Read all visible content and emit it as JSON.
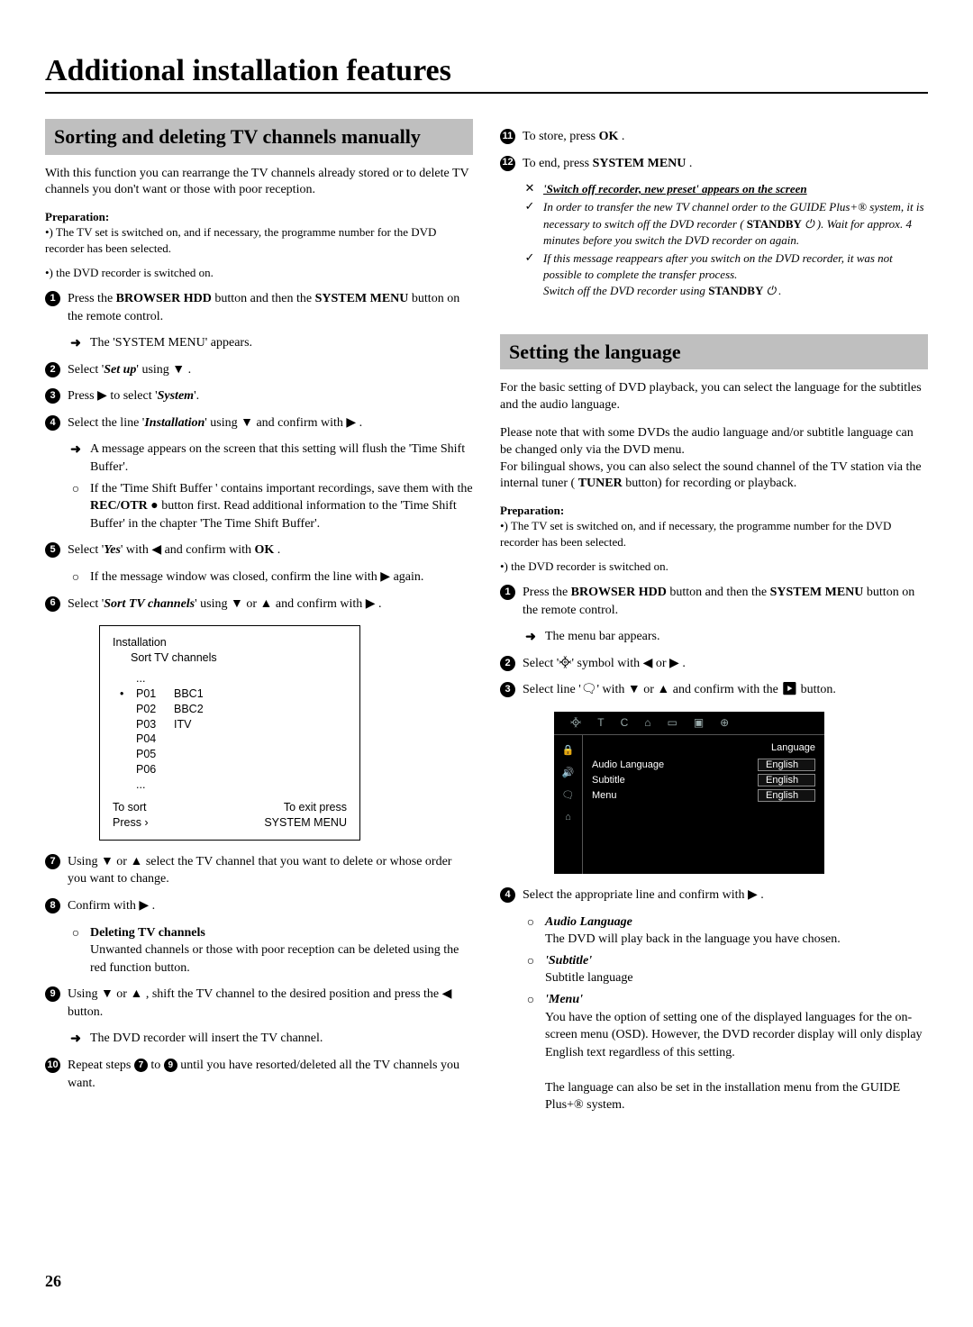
{
  "pageTitle": "Additional installation features",
  "pageNumber": 26,
  "sec1": {
    "heading": "Sorting and deleting TV channels manually",
    "intro": "With this function you can rearrange the TV channels already stored or to delete TV channels you don't want or those with poor reception.",
    "prepLabel": "Preparation:",
    "prep1": "•) The TV set is switched on, and if necessary, the programme number for the DVD recorder has been selected.",
    "prep2": "•) the DVD recorder is switched on.",
    "step1_a": "Press the ",
    "step1_b": "BROWSER HDD",
    "step1_c": " button and then the ",
    "step1_d": "SYSTEM MENU",
    "step1_e": " button on the remote control.",
    "step1_sub": "The 'SYSTEM MENU' appears.",
    "step2_a": "Select '",
    "step2_b": "Set up",
    "step2_c": "' using ▼ .",
    "step3_a": "Press ▶ to select '",
    "step3_b": "System",
    "step3_c": "'.",
    "step4_a": "Select the line '",
    "step4_b": "Installation",
    "step4_c": "' using ▼ and confirm with ▶ .",
    "step4_sub1": "A message appears on the screen that this setting will flush the 'Time Shift Buffer'.",
    "step4_sub2a": "If the 'Time Shift Buffer ' contains important recordings, save them with the ",
    "step4_sub2b": "REC/OTR",
    "step4_sub2c": " ● button first. Read additional information to the 'Time Shift Buffer' in the chapter 'The Time Shift Buffer'.",
    "step5_a": "Select '",
    "step5_b": "Yes",
    "step5_c": "' with ◀ and confirm with ",
    "step5_d": "OK",
    "step5_e": " .",
    "step5_subA": "If the message window was closed, confirm the line with ▶ again.",
    "step6_a": "Select '",
    "step6_b": "Sort TV channels",
    "step6_c": "' using ▼ or ▲ and confirm with ▶ .",
    "osd": {
      "l1": "Installation",
      "l2": "Sort TV channels",
      "rows": [
        {
          "dot": "",
          "p": "...",
          "c": ""
        },
        {
          "dot": "•",
          "p": "P01",
          "c": "BBC1"
        },
        {
          "dot": "",
          "p": "P02",
          "c": "BBC2"
        },
        {
          "dot": "",
          "p": "P03",
          "c": "ITV"
        },
        {
          "dot": "",
          "p": "P04",
          "c": ""
        },
        {
          "dot": "",
          "p": "P05",
          "c": ""
        },
        {
          "dot": "",
          "p": "P06",
          "c": ""
        },
        {
          "dot": "",
          "p": "...",
          "c": ""
        }
      ],
      "footL1": "To sort",
      "footL2": "Press ›",
      "footR1": "To exit press",
      "footR2": "SYSTEM MENU"
    },
    "step7": "Using ▼ or ▲ select the TV channel that you want to delete or whose order you want to change.",
    "step8": "Confirm with ▶ .",
    "step8_subT": "Deleting TV channels",
    "step8_subB": "Unwanted channels or those with poor reception can be deleted using the red function button.",
    "step9": "Using ▼ or ▲ , shift the TV channel to the desired position and press the ◀ button.",
    "step9_sub": "The DVD recorder will insert the TV channel.",
    "step10_a": "Repeat steps ",
    "step10_b": " to ",
    "step10_c": " until you have resorted/deleted all the TV channels you want.",
    "step11_a": "To store, press ",
    "step11_b": "OK",
    "step11_c": " .",
    "step12_a": "To end, press ",
    "step12_b": "SYSTEM MENU",
    "step12_c": " .",
    "noteHeader": "'Switch off recorder, new preset' appears on the screen",
    "noteA1": "In order to transfer the new TV channel order to the GUIDE Plus+® system, it is necessary to switch off the DVD recorder ( ",
    "noteA2": "STANDBY",
    "noteA3": " ⏻ ). Wait for approx. 4 minutes before you switch the DVD recorder on again.",
    "noteB1": "If this message reappears after you switch on the DVD recorder, it was not possible to complete the transfer process.",
    "noteB2": "Switch off the DVD recorder using ",
    "noteB3": "STANDBY",
    "noteB4": " ⏻ ."
  },
  "sec2": {
    "heading": "Setting the language",
    "introA": "For the basic setting of DVD playback, you can select the language for the subtitles and the audio language.",
    "introB1": "Please note that with some DVDs the audio language and/or subtitle language can be changed only via the DVD menu.",
    "introB2a": "For bilingual shows, you can also select the sound channel of the TV station via the internal tuner ( ",
    "introB2b": "TUNER",
    "introB2c": " button) for recording or playback.",
    "prepLabel": "Preparation:",
    "prep1": "•) The TV set is switched on, and if necessary, the programme number for the DVD recorder has been selected.",
    "prep2": "•) the DVD recorder is switched on.",
    "step1_a": "Press the ",
    "step1_b": "BROWSER HDD",
    "step1_c": " button and then the ",
    "step1_d": "SYSTEM MENU",
    "step1_e": " button on the remote control.",
    "step1_sub": "The menu bar appears.",
    "step2": "Select '᳀' symbol with ◀ or ▶ .",
    "step3": "Select line '🗨' with ▼ or ▲ and confirm with the ▶ button.",
    "osd": {
      "title": "Language",
      "rows": [
        {
          "l": "Audio Language",
          "v": "English"
        },
        {
          "l": "Subtitle",
          "v": "English"
        },
        {
          "l": "Menu",
          "v": "English"
        }
      ]
    },
    "step4": "Select the appropriate line and confirm with ▶ .",
    "s4a_t": "Audio Language",
    "s4a_b": "The DVD will play back in the language you have chosen.",
    "s4b_t": "'Subtitle'",
    "s4b_b": "Subtitle language",
    "s4c_t": "'Menu'",
    "s4c_b1": "You have the option of setting one of the displayed languages for the on-screen menu (OSD). However, the DVD recorder display will only display English text regardless of this setting.",
    "s4c_b2": "The language can also be set in the installation menu from the GUIDE Plus+® system."
  }
}
